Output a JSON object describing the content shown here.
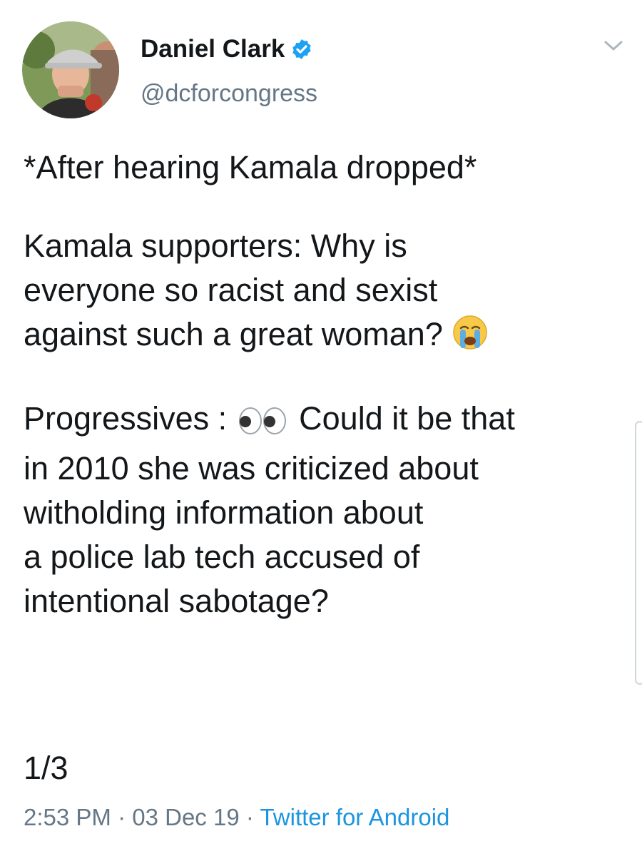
{
  "author": {
    "display_name": "Daniel Clark",
    "handle": "@dcforcongress",
    "verified": true,
    "avatar_icon": "profile-photo",
    "verified_icon": "verified-badge-icon"
  },
  "tweet": {
    "line_1": "*After hearing Kamala dropped*",
    "line_2": "Kamala supporters: Why is",
    "line_3": "everyone so racist and sexist",
    "line_4": "against such a great woman?",
    "line_4_emoji": "crying-face-emoji",
    "line_5_before": "Progressives :",
    "line_5_emoji": "eyes-emoji",
    "line_5_after": "Could it be that",
    "line_6": "in 2010 she was criticized about",
    "line_7": "witholding information about",
    "line_8": "a police lab tech accused of",
    "line_9": "intentional sabotage?",
    "thread_count": "1/3"
  },
  "meta": {
    "time": "2:53 PM",
    "separator": "·",
    "date": "03 Dec 19",
    "source": "Twitter for Android"
  },
  "menu": {
    "icon": "chevron-down-icon"
  },
  "colors": {
    "text": "#14171a",
    "secondary": "#657786",
    "link": "#1b95e0",
    "verified": "#1da1f2"
  }
}
